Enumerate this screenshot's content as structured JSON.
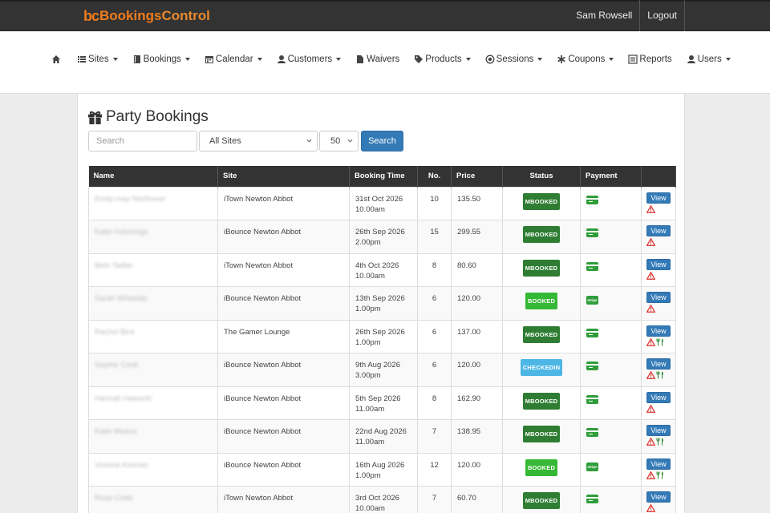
{
  "brand": {
    "prefix": "bc",
    "name_a": "Bookings",
    "name_b": "Control"
  },
  "top": {
    "user": "Sam Rowsell",
    "logout": "Logout"
  },
  "nav": [
    {
      "label": "",
      "icon": "home-icon",
      "caret": false
    },
    {
      "label": "Sites",
      "icon": "list-icon",
      "caret": true
    },
    {
      "label": "Bookings",
      "icon": "book-icon",
      "caret": true
    },
    {
      "label": "Calendar",
      "icon": "calendar-icon",
      "caret": true
    },
    {
      "label": "Customers",
      "icon": "user-icon",
      "caret": true
    },
    {
      "label": "Waivers",
      "icon": "file-icon",
      "caret": false
    },
    {
      "label": "Products",
      "icon": "tags-icon",
      "caret": true
    },
    {
      "label": "Sessions",
      "icon": "record-icon",
      "caret": true
    },
    {
      "label": "Coupons",
      "icon": "asterisk-icon",
      "caret": true
    },
    {
      "label": "Reports",
      "icon": "list-alt-icon",
      "caret": false
    },
    {
      "label": "Users",
      "icon": "user-icon",
      "caret": true
    }
  ],
  "page": {
    "title": "Party Bookings"
  },
  "filters": {
    "search_placeholder": "Search",
    "site_selected": "All Sites",
    "page_size_selected": "50",
    "search_button": "Search"
  },
  "table": {
    "headers": [
      "Name",
      "Site",
      "Booking Time",
      "No.",
      "Price",
      "Status",
      "Payment",
      ""
    ],
    "view_label": "View",
    "rows": [
      {
        "name": "Emily-may Northover",
        "site": "iTown Newton Abbot",
        "date": "31st Oct 2026",
        "time": "10.00am",
        "no": "10",
        "price": "135.50",
        "status": "MBOOKED",
        "payment": "card",
        "cutlery": false
      },
      {
        "name": "Katie Hutchings",
        "site": "iBounce Newton Abbot",
        "date": "26th Sep 2026",
        "time": "2.00pm",
        "no": "15",
        "price": "299.55",
        "status": "MBOOKED",
        "payment": "card",
        "cutlery": false
      },
      {
        "name": "Beth Tadler",
        "site": "iTown Newton Abbot",
        "date": "4th Oct 2026",
        "time": "10.00am",
        "no": "8",
        "price": "80.60",
        "status": "MBOOKED",
        "payment": "card",
        "cutlery": false
      },
      {
        "name": "Sarah Whaddip",
        "site": "iBounce Newton Abbot",
        "date": "13th Sep 2026",
        "time": "1.00pm",
        "no": "6",
        "price": "120.00",
        "status": "BOOKED",
        "payment": "stripe",
        "cutlery": false
      },
      {
        "name": "Rachel Bird",
        "site": "The Gamer Lounge",
        "date": "26th Sep 2026",
        "time": "1.00pm",
        "no": "6",
        "price": "137.00",
        "status": "MBOOKED",
        "payment": "card",
        "cutlery": true
      },
      {
        "name": "Sophie Cook",
        "site": "iBounce Newton Abbot",
        "date": "9th Aug 2026",
        "time": "3.00pm",
        "no": "6",
        "price": "120.00",
        "status": "CHECKEDIN",
        "payment": "card",
        "cutlery": true
      },
      {
        "name": "Hannah Haworth",
        "site": "iBounce Newton Abbot",
        "date": "5th Sep 2026",
        "time": "11.00am",
        "no": "8",
        "price": "162.90",
        "status": "MBOOKED",
        "payment": "card",
        "cutlery": false
      },
      {
        "name": "Katie Means",
        "site": "iBounce Newton Abbot",
        "date": "22nd Aug 2026",
        "time": "11.00am",
        "no": "7",
        "price": "138.95",
        "status": "MBOOKED",
        "payment": "card",
        "cutlery": true
      },
      {
        "name": "Victoria Keenan",
        "site": "iBounce Newton Abbot",
        "date": "16th Aug 2026",
        "time": "1.00pm",
        "no": "12",
        "price": "120.00",
        "status": "BOOKED",
        "payment": "stripe",
        "cutlery": true
      },
      {
        "name": "Rose Cobb",
        "site": "iTown Newton Abbot",
        "date": "3rd Oct 2026",
        "time": "10.00am",
        "no": "7",
        "price": "60.70",
        "status": "MBOOKED",
        "payment": "card",
        "cutlery": false
      }
    ]
  },
  "colors": {
    "brand_orange": "#f07c1b",
    "primary": "#337ab7",
    "mbooked": "#2e7d32",
    "booked": "#35b835",
    "checkedin": "#4db6e5",
    "warning": "#d9302c"
  },
  "payment_stripe_label": "stripe"
}
